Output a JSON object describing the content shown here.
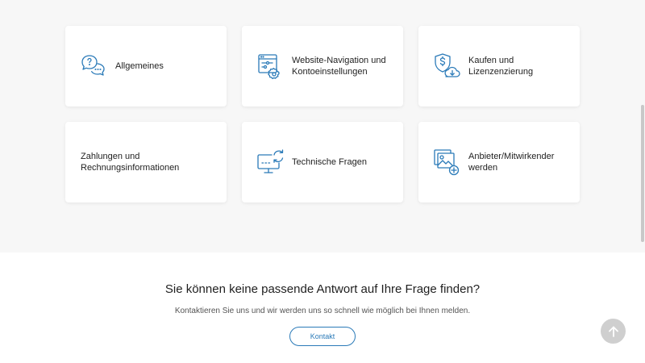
{
  "categories": [
    {
      "label": "Allgemeines",
      "icon": "speech-bubbles-question-icon"
    },
    {
      "label_line1": "Website-Navigation und",
      "label_line2": "Kontoeinstellungen",
      "icon": "browser-settings-icon"
    },
    {
      "label_line1": "Kaufen und",
      "label_line2": "Lizenzenzierung",
      "icon": "shield-dollar-cloud-icon"
    },
    {
      "label_line1": "Zahlungen und",
      "label_line2": "Rechnungsinformationen",
      "icon": null
    },
    {
      "label": "Technische Fragen",
      "icon": "monitor-refresh-icon"
    },
    {
      "label_line1": "Anbieter/Mitwirkender",
      "label_line2": "werden",
      "icon": "images-add-icon"
    }
  ],
  "contact": {
    "heading": "Sie können keine passende Antwort auf Ihre Frage finden?",
    "subtext": "Kontaktieren Sie uns und wir werden uns so schnell wie möglich bei Ihnen melden.",
    "button_label": "Kontakt"
  },
  "colors": {
    "accent": "#2a7ab8",
    "section_bg": "#f7f7f7",
    "card_bg": "#ffffff",
    "scroll_top_bg": "#cfcfcf"
  },
  "scroll_top_icon": "arrow-up-icon"
}
